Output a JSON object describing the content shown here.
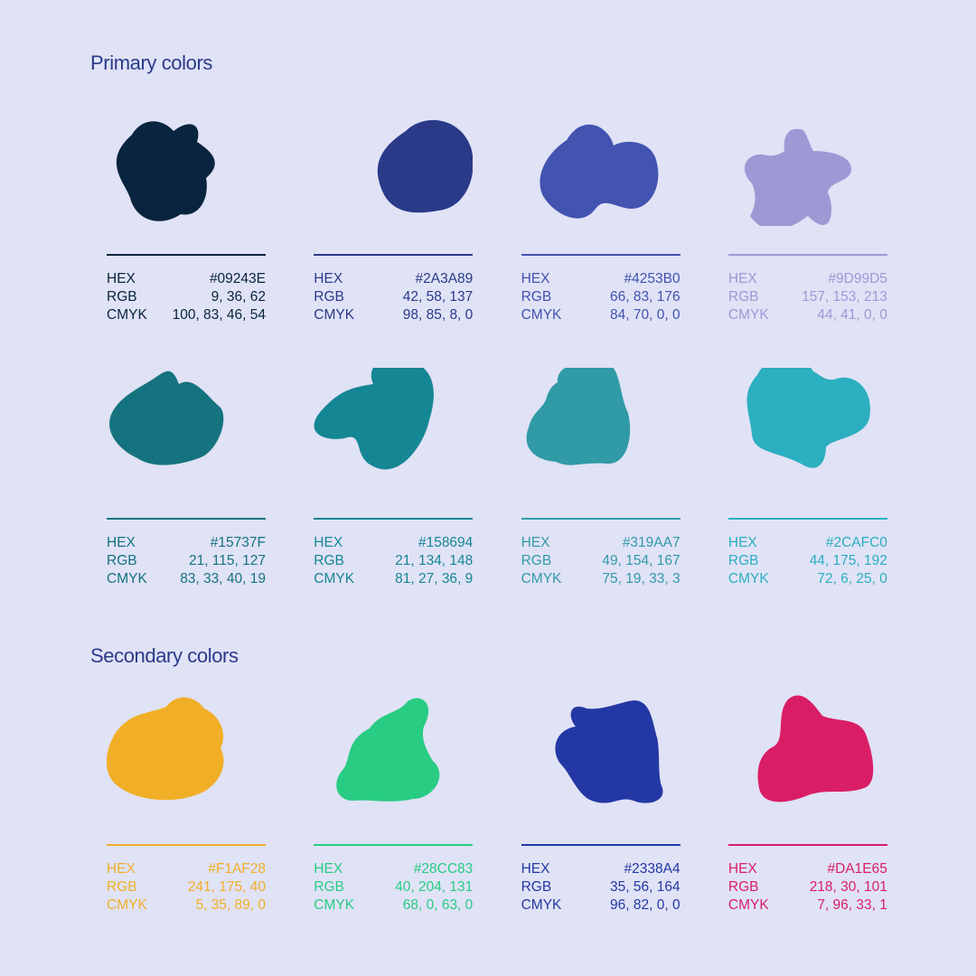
{
  "primary": {
    "title": "Primary colors",
    "swatches": [
      {
        "hex": "#09243E",
        "rgb": "9, 36, 62",
        "cmyk": "100, 83, 46, 54",
        "color": "#09243E",
        "text_color": "#09243E"
      },
      {
        "hex": "#2A3A89",
        "rgb": "42, 58, 137",
        "cmyk": "98, 85, 8, 0",
        "color": "#2A3A89",
        "text_color": "#2A3A89"
      },
      {
        "hex": "#4253B0",
        "rgb": "66, 83, 176",
        "cmyk": "84, 70, 0, 0",
        "color": "#4253B0",
        "text_color": "#4253B0"
      },
      {
        "hex": "#9D99D5",
        "rgb": "157, 153, 213",
        "cmyk": "44, 41, 0, 0",
        "color": "#9D99D5",
        "text_color": "#9D99D5"
      },
      {
        "hex": "#15737F",
        "rgb": "21, 115, 127",
        "cmyk": "83, 33, 40, 19",
        "color": "#15737F",
        "text_color": "#15737F"
      },
      {
        "hex": "#158694",
        "rgb": "21, 134, 148",
        "cmyk": "81, 27, 36, 9",
        "color": "#158694",
        "text_color": "#158694"
      },
      {
        "hex": "#319AA7",
        "rgb": "49, 154, 167",
        "cmyk": "75, 19, 33, 3",
        "color": "#319AA7",
        "text_color": "#319AA7"
      },
      {
        "hex": "#2CAFC0",
        "rgb": "44, 175, 192",
        "cmyk": "72, 6, 25, 0",
        "color": "#2CAFC0",
        "text_color": "#2CAFC0"
      }
    ]
  },
  "secondary": {
    "title": "Secondary colors",
    "swatches": [
      {
        "hex": "#F1AF28",
        "rgb": "241, 175, 40",
        "cmyk": "5, 35, 89, 0",
        "color": "#F1AF28",
        "text_color": "#F1AF28"
      },
      {
        "hex": "#28CC83",
        "rgb": "40, 204, 131",
        "cmyk": "68, 0, 63, 0",
        "color": "#28CC83",
        "text_color": "#28CC83"
      },
      {
        "hex": "#2338A4",
        "rgb": "35, 56, 164",
        "cmyk": "96, 82, 0, 0",
        "color": "#2338A4",
        "text_color": "#2338A4"
      },
      {
        "hex": "#DA1E65",
        "rgb": "218, 30, 101",
        "cmyk": "7, 96, 33, 1",
        "color": "#DA1E65",
        "text_color": "#DA1E65"
      }
    ]
  },
  "labels": {
    "hex": "HEX",
    "rgb": "RGB",
    "cmyk": "CMYK"
  }
}
